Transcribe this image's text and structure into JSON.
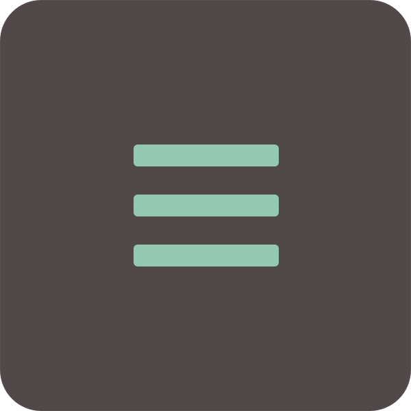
{
  "app_tile": {
    "icon": "hamburger-menu-icon",
    "background_color": "#514849",
    "border_color": "#5a5152"
  },
  "menu_icon": {
    "bar_color": "#93c9b0",
    "bar_count": 3
  }
}
